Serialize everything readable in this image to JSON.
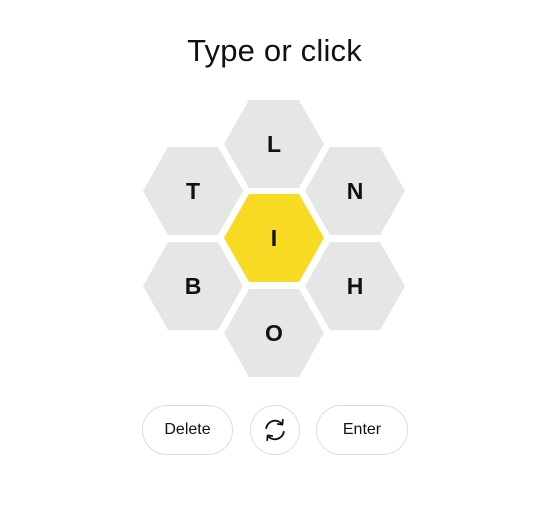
{
  "title": "Type or click",
  "colors": {
    "center_fill": "#f7da21",
    "outer_fill": "#e6e6e6",
    "text": "#111111"
  },
  "hive": {
    "center": {
      "letter": "I"
    },
    "outer": [
      {
        "id": "top",
        "letter": "L"
      },
      {
        "id": "upper-left",
        "letter": "T"
      },
      {
        "id": "upper-right",
        "letter": "N"
      },
      {
        "id": "lower-left",
        "letter": "B"
      },
      {
        "id": "lower-right",
        "letter": "H"
      },
      {
        "id": "bottom",
        "letter": "O"
      }
    ]
  },
  "controls": {
    "delete_label": "Delete",
    "shuffle_icon": "shuffle-icon",
    "enter_label": "Enter"
  }
}
